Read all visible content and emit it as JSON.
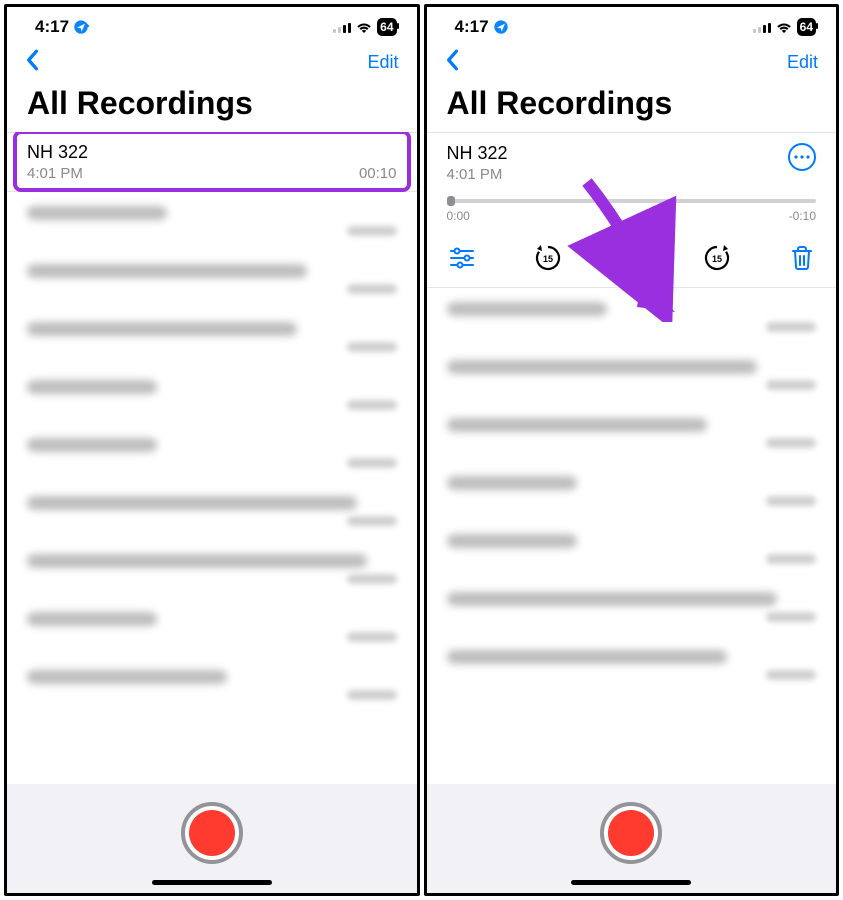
{
  "status": {
    "time": "4:17",
    "battery": "64"
  },
  "nav": {
    "edit": "Edit"
  },
  "title": "All Recordings",
  "left": {
    "row": {
      "name": "NH 322",
      "time": "4:01 PM",
      "dur": "00:10"
    },
    "blur_widths": [
      140,
      280,
      270,
      130,
      130,
      330,
      340,
      130,
      200
    ]
  },
  "right": {
    "player": {
      "name": "NH 322",
      "time": "4:01 PM",
      "scrub_start": "0:00",
      "scrub_end": "-0:10"
    },
    "blur_widths": [
      160,
      310,
      260,
      130,
      130,
      330,
      280
    ]
  },
  "colors": {
    "accent": "#007aff",
    "highlight": "#9a2fe0",
    "record": "#ff3b30"
  }
}
